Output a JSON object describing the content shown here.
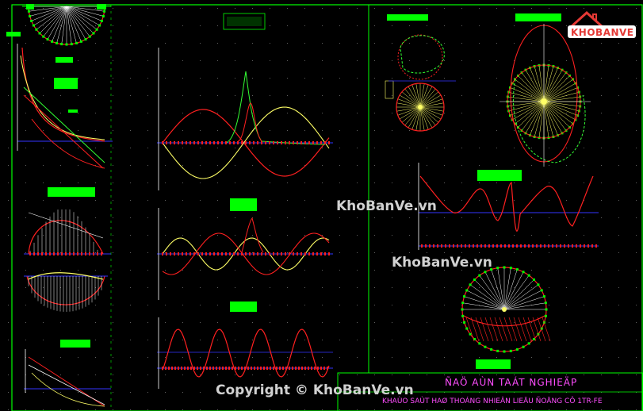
{
  "watermark": {
    "brand": "KhoBanVe.vn",
    "copyright": "Copyright © KhoBanVe.vn",
    "logo_text": "KHOBANVE"
  },
  "title_block": {
    "main": "ÑAÖ AÙN TAÁT NGHIEÄP",
    "sub": "KHAÙO SAÙT HAØ THOÁNG NHIEÂN LIEÄU ÑOÄNG CÔ 1TR-FE"
  },
  "colors": {
    "background": "#000000",
    "frame": "#00ff00",
    "axis": "#3333ff",
    "curve_red": "#ff2020",
    "curve_yellow": "#ffff66",
    "curve_green": "#33ff33",
    "label_fill": "#00ff00",
    "grid_dot": "#606060",
    "title_text": "#ff4dff",
    "logo_red": "#e53935"
  }
}
